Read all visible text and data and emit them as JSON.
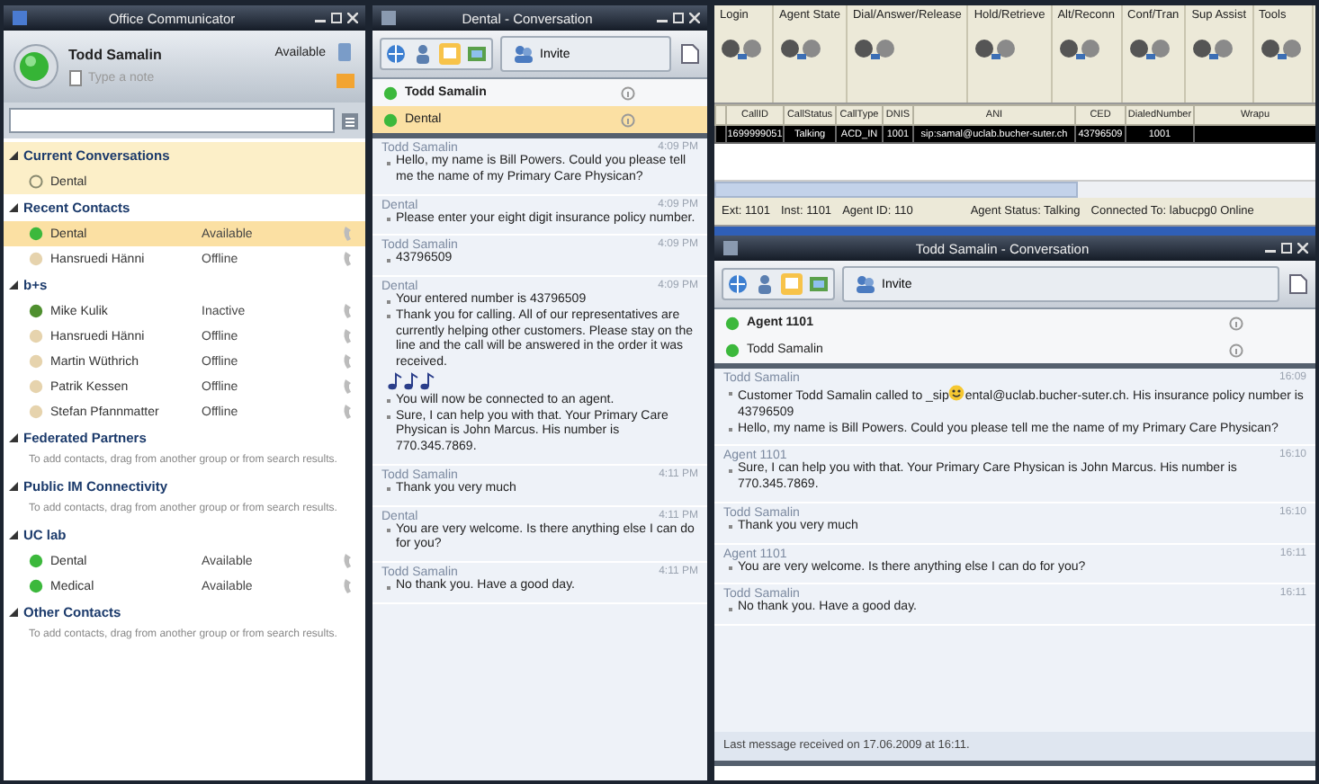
{
  "communicator": {
    "title": "Office Communicator",
    "user": {
      "name": "Todd Samalin",
      "status": "Available",
      "note_placeholder": "Type a note"
    },
    "groups": [
      {
        "name": "Current Conversations",
        "items": [
          {
            "kind": "conversation",
            "name": "Dental",
            "selected": false
          }
        ]
      },
      {
        "name": "Recent Contacts",
        "items": [
          {
            "kind": "contact",
            "name": "Dental",
            "status": "Available",
            "color": "#3cb83c",
            "selected": true
          },
          {
            "kind": "contact",
            "name": "Hansruedi Hänni",
            "status": "Offline",
            "color": "#e6d3ad",
            "selected": false
          }
        ]
      },
      {
        "name": "b+s",
        "items": [
          {
            "kind": "contact",
            "name": "Mike Kulik",
            "status": "Inactive",
            "color": "#4f8f2f",
            "selected": false
          },
          {
            "kind": "contact",
            "name": "Hansruedi Hänni",
            "status": "Offline",
            "color": "#e6d3ad",
            "selected": false
          },
          {
            "kind": "contact",
            "name": "Martin Wüthrich",
            "status": "Offline",
            "color": "#e6d3ad",
            "selected": false
          },
          {
            "kind": "contact",
            "name": "Patrik Kessen",
            "status": "Offline",
            "color": "#e6d3ad",
            "selected": false
          },
          {
            "kind": "contact",
            "name": "Stefan Pfannmatter",
            "status": "Offline",
            "color": "#e6d3ad",
            "selected": false
          }
        ]
      },
      {
        "name": "Federated Partners",
        "items": [
          {
            "kind": "hint",
            "name": "To add contacts, drag from another group or from search results."
          }
        ]
      },
      {
        "name": "Public IM Connectivity",
        "items": [
          {
            "kind": "hint",
            "name": "To add contacts, drag from another group or from search results."
          }
        ]
      },
      {
        "name": "UC lab",
        "items": [
          {
            "kind": "contact",
            "name": "Dental",
            "status": "Available",
            "color": "#3cb83c",
            "selected": false
          },
          {
            "kind": "contact",
            "name": "Medical",
            "status": "Available",
            "color": "#3cb83c",
            "selected": false
          }
        ]
      },
      {
        "name": "Other Contacts",
        "items": [
          {
            "kind": "hint",
            "name": "To add contacts, drag from another group or from search results."
          }
        ]
      }
    ]
  },
  "dental_conversation": {
    "title": "Dental - Conversation",
    "invite": "Invite",
    "participants": [
      {
        "name": "Todd Samalin",
        "self": true,
        "selected": false
      },
      {
        "name": "Dental",
        "self": false,
        "selected": true
      }
    ],
    "messages": [
      {
        "sender": "Todd Samalin",
        "time": "4:09 PM",
        "lines": [
          {
            "kind": "text",
            "text": "Hello, my name is Bill Powers. Could you please tell me the name of my Primary Care Physican?"
          }
        ]
      },
      {
        "sender": "Dental",
        "time": "4:09 PM",
        "lines": [
          {
            "kind": "text",
            "text": "Please enter your eight digit insurance policy number."
          }
        ]
      },
      {
        "sender": "Todd Samalin",
        "time": "4:09 PM",
        "lines": [
          {
            "kind": "text",
            "text": "43796509"
          }
        ]
      },
      {
        "sender": "Dental",
        "time": "4:09 PM",
        "lines": [
          {
            "kind": "text",
            "text": "Your entered number is 43796509"
          },
          {
            "kind": "text",
            "text": "Thank you for calling. All of our representatives are currently helping other customers. Please stay on the line and the call will be answered in the order it was received."
          },
          {
            "kind": "notes"
          },
          {
            "kind": "text",
            "text": "You will now be connected to an agent."
          },
          {
            "kind": "text",
            "text": "Sure, I can help you with that. Your Primary Care Physican is John Marcus. His number is 770.345.7869."
          }
        ]
      },
      {
        "sender": "Todd Samalin",
        "time": "4:11 PM",
        "lines": [
          {
            "kind": "text",
            "text": "Thank you very much"
          }
        ]
      },
      {
        "sender": "Dental",
        "time": "4:11 PM",
        "lines": [
          {
            "kind": "text",
            "text": "You are very welcome. Is there anything else I can do for you?"
          }
        ]
      },
      {
        "sender": "Todd Samalin",
        "time": "4:11 PM",
        "lines": [
          {
            "kind": "text",
            "text": "No thank you. Have a good day."
          }
        ]
      }
    ]
  },
  "agent_toolbar": {
    "groups": [
      "Login",
      "Agent State",
      "Dial/Answer/Release",
      "Hold/Retrieve",
      "Alt/Reconn",
      "Conf/Tran",
      "Sup Assist",
      "Tools"
    ],
    "table": {
      "columns": [
        "CallID",
        "CallStatus",
        "CallType",
        "DNIS",
        "ANI",
        "CED",
        "DialedNumber",
        "Wrapu"
      ],
      "rows": [
        {
          "selected": true,
          "cells": [
            "1699999051",
            "Talking",
            "ACD_IN",
            "1001",
            "sip:samal@uclab.bucher-suter.ch",
            "43796509",
            "1001",
            ""
          ]
        }
      ]
    },
    "status": [
      "Ext: 1101",
      "Inst: 1101",
      "Agent ID: 110",
      "Agent Status: Talking",
      "Connected To: labucpg0 Online"
    ]
  },
  "agent_conversation": {
    "title": "Todd Samalin - Conversation",
    "invite": "Invite",
    "participants": [
      {
        "name": "Agent 1101",
        "self": true,
        "selected": false
      },
      {
        "name": "Todd Samalin",
        "self": false,
        "selected": false
      }
    ],
    "messages": [
      {
        "sender": "Todd Samalin",
        "time": "16:09",
        "lines": [
          {
            "kind": "emoticon",
            "before": "Customer Todd Samalin called to _sip",
            "after": "ental@uclab.bucher-suter.ch. His insurance policy number is 43796509"
          },
          {
            "kind": "text",
            "text": "Hello, my name is Bill Powers. Could you please tell me the name of my Primary Care Physican?"
          }
        ]
      },
      {
        "sender": "Agent 1101",
        "time": "16:10",
        "lines": [
          {
            "kind": "text",
            "text": "Sure, I can help you with that. Your Primary Care Physican is John Marcus. His number is 770.345.7869."
          }
        ]
      },
      {
        "sender": "Todd Samalin",
        "time": "16:10",
        "lines": [
          {
            "kind": "text",
            "text": "Thank you very much"
          }
        ]
      },
      {
        "sender": "Agent 1101",
        "time": "16:11",
        "lines": [
          {
            "kind": "text",
            "text": "You are very welcome. Is there anything else I can do for you?"
          }
        ]
      },
      {
        "sender": "Todd Samalin",
        "time": "16:11",
        "lines": [
          {
            "kind": "text",
            "text": "No thank you. Have a good day."
          }
        ]
      }
    ],
    "footer": "Last message received on 17.06.2009 at 16:11."
  }
}
